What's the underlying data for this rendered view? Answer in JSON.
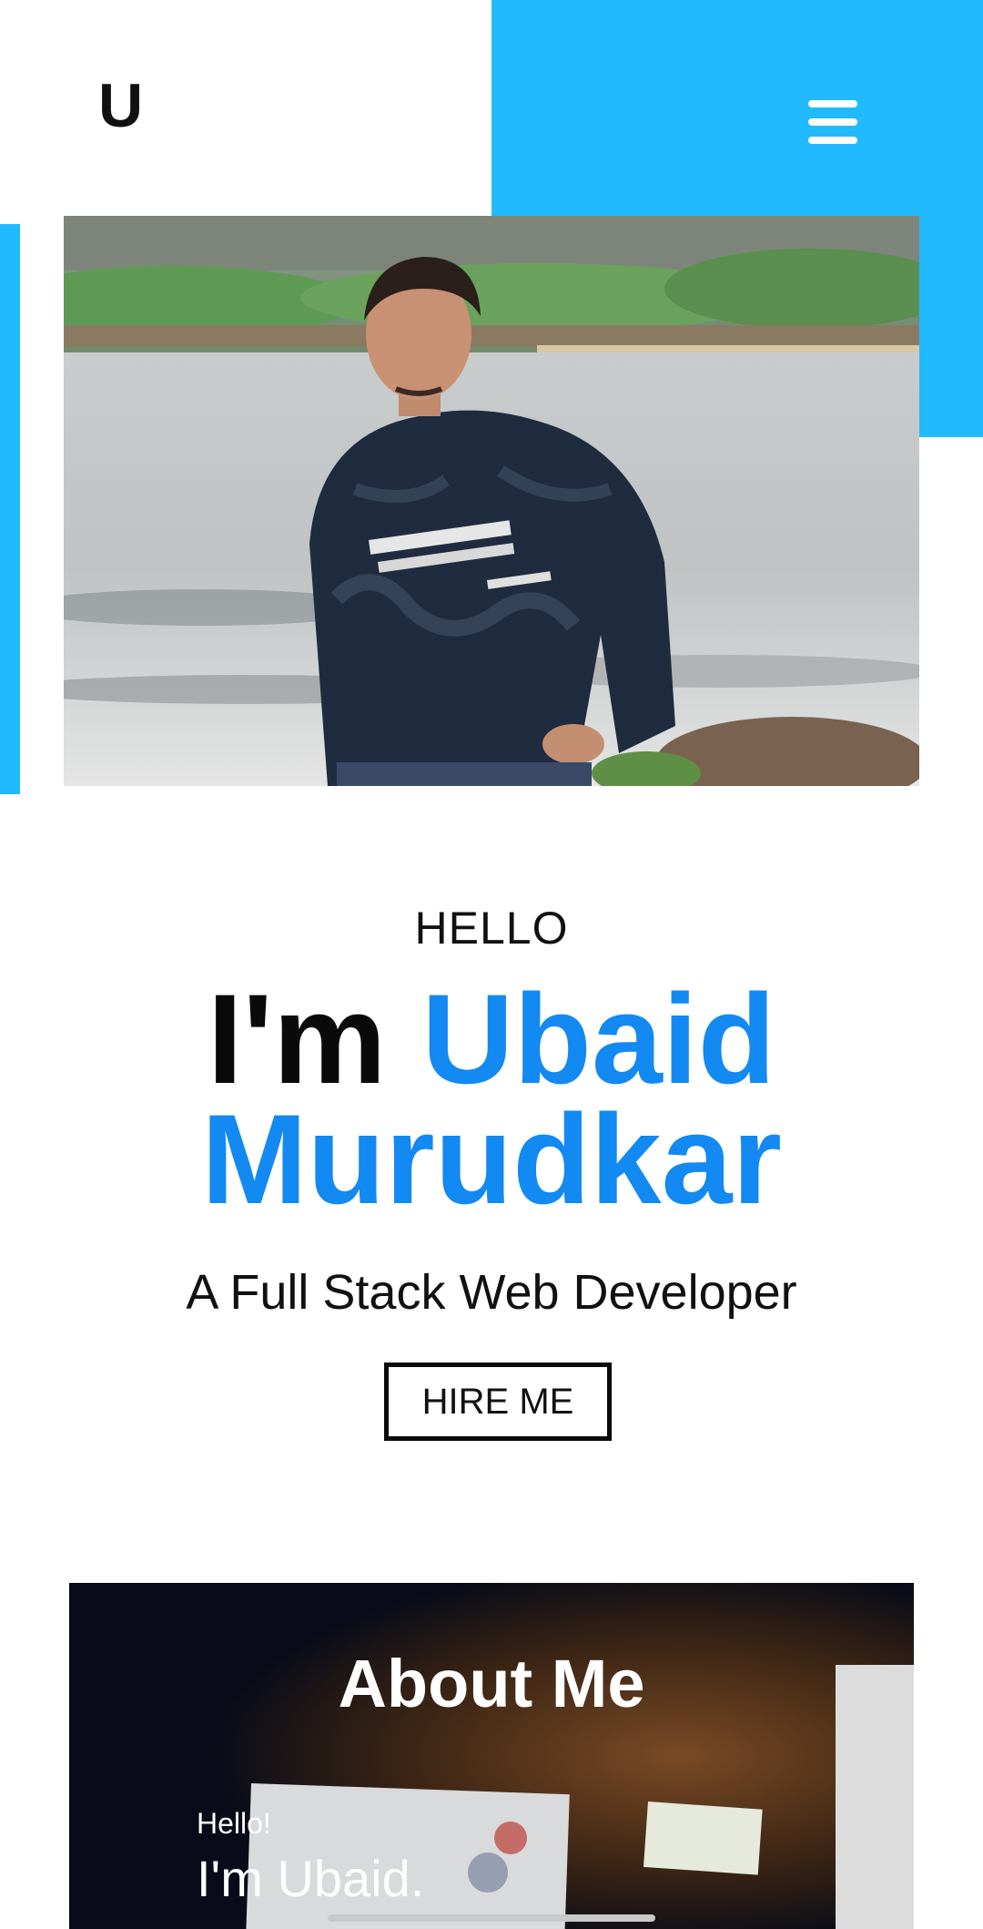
{
  "header": {
    "logo_text": "U",
    "menu_icon": "hamburger-menu-icon"
  },
  "hero": {
    "greeting": "HELLO",
    "name_prefix": "I'm",
    "name_first": "Ubaid",
    "name_last": "Murudkar",
    "role": "A Full Stack Web Developer",
    "cta_label": "HIRE ME"
  },
  "about": {
    "title": "About Me",
    "hello": "Hello!",
    "intro": "I'm Ubaid."
  },
  "colors": {
    "accent_block": "#22baff",
    "name_accent": "#1389f2",
    "text": "#111111"
  }
}
